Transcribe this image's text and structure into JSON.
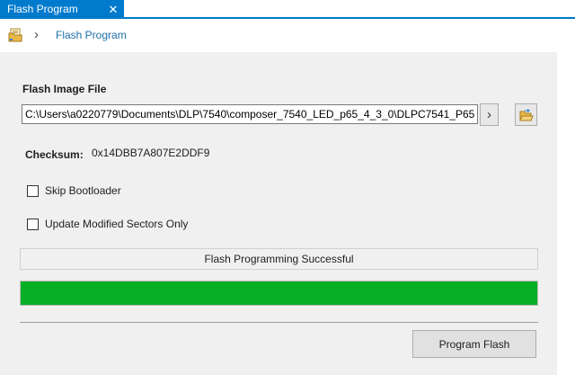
{
  "tab": {
    "title": "Flash Program",
    "close_glyph": "✕"
  },
  "breadcrumb": {
    "icon": "folder-icon",
    "separator": "›",
    "current": "Flash Program"
  },
  "form": {
    "image_file_label": "Flash Image File",
    "image_file_value": "C:\\Users\\a0220779\\Documents\\DLP\\7540\\composer_7540_LED_p65_4_3_0\\DLPC7541_P65",
    "next_button_glyph": "›",
    "browse_icon": "open-folder-icon",
    "checksum_label": "Checksum:",
    "checksum_value": "0x14DBB7A807E2DDF9",
    "skip_bootloader_label": "Skip Bootloader",
    "skip_bootloader_checked": false,
    "update_sectors_label": "Update Modified Sectors Only",
    "update_sectors_checked": false
  },
  "status": {
    "message": "Flash Programming Successful",
    "progress": 1.0
  },
  "actions": {
    "program_label": "Program Flash"
  },
  "colors": {
    "accent": "#007acc",
    "progress_fill": "#06b025",
    "breadcrumb_text": "#1f6fa8"
  }
}
